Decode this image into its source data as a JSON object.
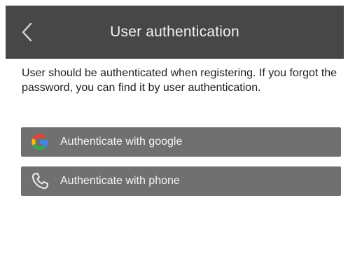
{
  "header": {
    "title": "User authentication",
    "back_icon": "chevron-left-icon"
  },
  "intro": {
    "text": "User should be authenticated when registering. If you forgot the password, you can find it by user authentication."
  },
  "auth_options": [
    {
      "label": "Authenticate with google",
      "icon": "google-icon"
    },
    {
      "label": "Authenticate with phone",
      "icon": "phone-icon"
    }
  ],
  "colors": {
    "header_bg": "#474747",
    "button_bg": "#707070",
    "google_blue": "#4285F4",
    "google_red": "#EA4335",
    "google_yellow": "#FBBC05",
    "google_green": "#34A853"
  }
}
